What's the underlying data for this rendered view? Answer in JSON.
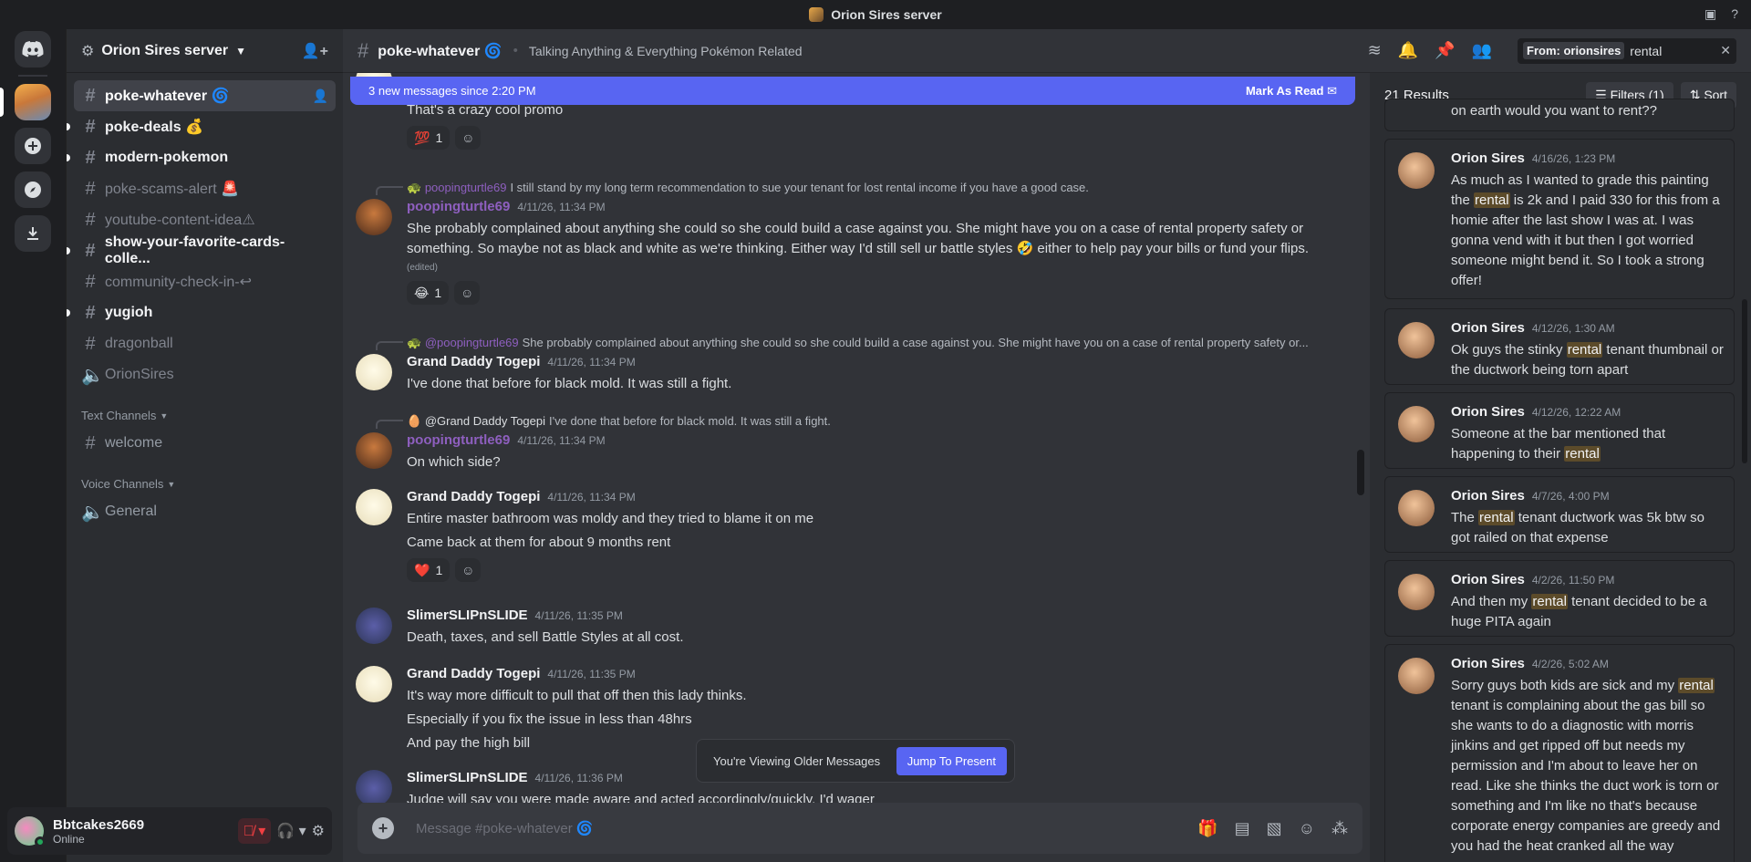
{
  "window": {
    "title": "Orion Sires server"
  },
  "server": {
    "name": "Orion Sires server"
  },
  "channels": [
    {
      "name": "poke-whatever 🌀",
      "state": "active"
    },
    {
      "name": "poke-deals 💰",
      "state": "unread"
    },
    {
      "name": "modern-pokemon",
      "state": "unread"
    },
    {
      "name": "poke-scams-alert 🚨",
      "state": "muted"
    },
    {
      "name": "youtube-content-idea⚠",
      "state": "muted"
    },
    {
      "name": "show-your-favorite-cards-colle...",
      "state": "unread"
    },
    {
      "name": "community-check-in-↩",
      "state": "muted"
    },
    {
      "name": "yugioh",
      "state": "unread"
    },
    {
      "name": "dragonball",
      "state": "muted"
    },
    {
      "name": "OrionSires",
      "state": "muted"
    }
  ],
  "categories": {
    "text": "Text Channels",
    "text_channel": "welcome",
    "voice": "Voice Channels",
    "voice_channel": "General"
  },
  "user": {
    "name": "Bbtcakes2669",
    "status": "Online"
  },
  "header": {
    "channel": "poke-whatever 🌀",
    "topic": "Talking Anything & Everything Pokémon Related",
    "search_chip": "From: orionsires",
    "search_query": "rental"
  },
  "newbar": {
    "text": "3 new messages since 2:20 PM",
    "mark": "Mark As Read"
  },
  "messages": {
    "m0": {
      "text": "That's a crazy cool promo",
      "reaction": "💯",
      "count": "1"
    },
    "m1": {
      "reply_name": "poopingturtle69",
      "reply_text": "I still stand by my long term recommendation to sue your tenant for lost rental income if you have a good case.",
      "author": "poopingturtle69",
      "color": "#8e5fbf",
      "time": "4/11/26, 11:34 PM",
      "text": "She probably complained about anything she could so she could build a case against you. She might have you on a case of rental property safety or something. So maybe not as black and white as we're thinking. Either way I'd still sell ur battle styles 🤣 either to help pay your bills or fund your flips.",
      "edited": "(edited)",
      "reaction": "😂",
      "count": "1"
    },
    "m2": {
      "reply_name": "@poopingturtle69",
      "reply_text": "She probably complained about anything she could so she could build a case against you. She might have you on a case of rental property safety or...",
      "author": "Grand Daddy Togepi",
      "time": "4/11/26, 11:34 PM",
      "text": "I've done that before for black mold. It was still a fight."
    },
    "m3": {
      "reply_name": "@Grand Daddy Togepi",
      "reply_text": "I've done that before for black mold. It was still a fight.",
      "author": "poopingturtle69",
      "time": "4/11/26, 11:34 PM",
      "text": "On which side?"
    },
    "m4": {
      "author": "Grand Daddy Togepi",
      "time": "4/11/26, 11:34 PM",
      "text1": "Entire master bathroom was moldy and they tried to blame it on me",
      "text2": "Came back at them for about 9 months rent",
      "reaction": "❤️",
      "count": "1"
    },
    "m5": {
      "author": "SlimerSLIPnSLIDE",
      "time": "4/11/26, 11:35 PM",
      "text": "Death, taxes, and sell Battle Styles at all cost."
    },
    "m6": {
      "author": "Grand Daddy Togepi",
      "time": "4/11/26, 11:35 PM",
      "text1": "It's way more difficult to pull that off then this lady thinks.",
      "text2": "Especially if you fix the issue in less than 48hrs",
      "text3": "And pay the high bill"
    },
    "m7": {
      "author": "SlimerSLIPnSLIDE",
      "time": "4/11/26, 11:36 PM",
      "text": "Judge will say you were made aware and acted accordingly/quickly. I'd wager"
    }
  },
  "older": {
    "text": "You're Viewing Older Messages",
    "jump": "Jump To Present"
  },
  "composer": {
    "placeholder": "Message #poke-whatever 🌀"
  },
  "results": {
    "count": "21 Results",
    "filters": "Filters (1)",
    "sort": "Sort",
    "partial": "on earth would you want to rent??",
    "cards": [
      {
        "author": "Orion Sires",
        "time": "4/16/26, 1:23 PM",
        "pre": "As much as I wanted to grade this painting the ",
        "hl": "rental",
        "post": " is 2k and I paid 330 for this from a homie after the last show I was at. I was gonna vend with it but then I got worried someone might bend it. So I took a strong offer!"
      },
      {
        "author": "Orion Sires",
        "time": "4/12/26, 1:30 AM",
        "pre": "Ok guys the stinky ",
        "hl": "rental",
        "post": " tenant thumbnail or the ductwork being torn apart"
      },
      {
        "author": "Orion Sires",
        "time": "4/12/26, 12:22 AM",
        "pre": "Someone at the bar mentioned that happening to their ",
        "hl": "rental",
        "post": ""
      },
      {
        "author": "Orion Sires",
        "time": "4/7/26, 4:00 PM",
        "pre": "The ",
        "hl": "rental",
        "post": " tenant ductwork was 5k btw so got railed on that expense"
      },
      {
        "author": "Orion Sires",
        "time": "4/2/26, 11:50 PM",
        "pre": "And then my ",
        "hl": "rental",
        "post": " tenant decided to be a huge PITA again"
      },
      {
        "author": "Orion Sires",
        "time": "4/2/26, 5:02 AM",
        "pre": "Sorry guys both kids are sick and my ",
        "hl": "rental",
        "post": " tenant is complaining about the gas bill so she wants to do a diagnostic with morris jinkins and get ripped off but needs my permission and I'm about to leave her on read. Like she thinks the duct work is torn or something and I'm like no that's because corporate energy companies are greedy and you had the heat cranked all the way"
      }
    ]
  }
}
